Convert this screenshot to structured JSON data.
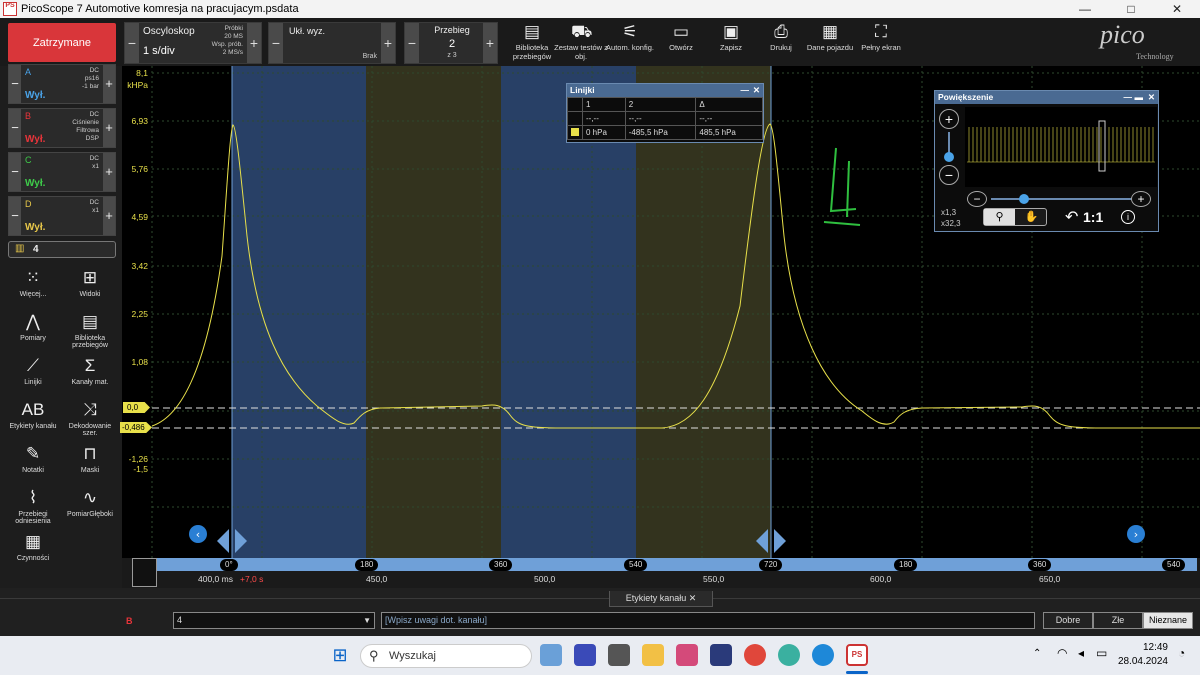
{
  "window": {
    "title": "PicoScope 7 Automotive komresja na pracujacym.psdata",
    "logo_text": "PS",
    "minimize": "—",
    "maximize": "□",
    "close": "✕"
  },
  "toolbar": {
    "stop_label": "Zatrzymane",
    "scope": {
      "title": "Oscyloskop",
      "timebase": "1 s/div",
      "samples_label": "Próbki",
      "samples_value": "20 MS",
      "rate_label": "Wsp. prób.",
      "rate_value": "2 MS/s"
    },
    "trigger": {
      "title": "Ukł. wyz.",
      "value": "Brak"
    },
    "waveform": {
      "title": "Przebieg",
      "value": "2",
      "of": "z 3"
    },
    "buttons": [
      {
        "label": "Biblioteka przebiegów",
        "icon": "library-icon"
      },
      {
        "label": "Zestaw testów z obj.",
        "icon": "car-icon"
      },
      {
        "label": "Autom. konfig.",
        "icon": "wand-icon"
      },
      {
        "label": "Otwórz",
        "icon": "folder-icon"
      },
      {
        "label": "Zapisz",
        "icon": "save-icon"
      },
      {
        "label": "Drukuj",
        "icon": "print-icon"
      },
      {
        "label": "Dane pojazdu",
        "icon": "clipboard-icon"
      },
      {
        "label": "Pełny ekran",
        "icon": "fullscreen-icon"
      }
    ],
    "brand": "pico",
    "brand_sub": "Technology"
  },
  "channels": [
    {
      "name": "A",
      "state": "Wył.",
      "info1": "DC",
      "info2": "ps16",
      "info3": "-1 bar",
      "info4": "",
      "color": "#4aa3e8"
    },
    {
      "name": "B",
      "state": "Wył.",
      "info1": "DC",
      "info2": "Ciśnienie",
      "info3": "Filtrowa",
      "info4": "DSP",
      "color": "#e8343a"
    },
    {
      "name": "C",
      "state": "Wył.",
      "info1": "DC",
      "info2": "x1",
      "info3": "",
      "info4": "",
      "color": "#3ecc4a"
    },
    {
      "name": "D",
      "state": "Wył.",
      "info1": "DC",
      "info2": "x1",
      "info3": "",
      "info4": "",
      "color": "#e8c84a"
    }
  ],
  "math_count": "4",
  "tools": [
    {
      "label": "Więcej...",
      "icon": "grid-dots-icon",
      "glyph": "⁙"
    },
    {
      "label": "Widoki",
      "icon": "views-icon",
      "glyph": "⊞"
    },
    {
      "label": "Pomiary",
      "icon": "compass-icon",
      "glyph": "⋀"
    },
    {
      "label": "Biblioteka przebiegów",
      "icon": "library-icon",
      "glyph": "▤"
    },
    {
      "label": "Linijki",
      "icon": "ruler-icon",
      "glyph": "⟋"
    },
    {
      "label": "Kanały mat.",
      "icon": "sigma-icon",
      "glyph": "Σ"
    },
    {
      "label": "Etykiety kanału",
      "icon": "abcd-icon",
      "glyph": "AB"
    },
    {
      "label": "Dekodowanie szer.",
      "icon": "decode-icon",
      "glyph": "⤨"
    },
    {
      "label": "Notatki",
      "icon": "notes-icon",
      "glyph": "✎"
    },
    {
      "label": "Maski",
      "icon": "mask-icon",
      "glyph": "⊓"
    },
    {
      "label": "Przebiegi odniesienia",
      "icon": "reference-icon",
      "glyph": "⌇"
    },
    {
      "label": "PomiarGłęboki",
      "icon": "deep-measure-icon",
      "glyph": "∿"
    },
    {
      "label": "Czynności",
      "icon": "clapper-icon",
      "glyph": "▦"
    }
  ],
  "plot": {
    "y_unit": "kHPa",
    "y_ticks": [
      "8,1",
      "6,93",
      "5,76",
      "4,59",
      "3,42",
      "2,25",
      "1,08",
      "-1,26",
      "-1,5"
    ],
    "marker_ticks": [
      "0,0",
      "-0,486"
    ],
    "ruler_hpa": [
      0,
      -485.5
    ],
    "colors": {
      "trace": "#e8e04a",
      "shade_blue": "#3a5a8a",
      "shade_olive": "#3f3f22"
    },
    "handwritten": "4",
    "timeline_rotation": [
      "0°",
      "180",
      "360",
      "540",
      "720",
      "180",
      "360",
      "540"
    ],
    "time_labels": [
      "400,0 ms",
      "450,0",
      "500,0",
      "550,0",
      "600,0",
      "650,0"
    ],
    "time_offset": "+7,0 s"
  },
  "rulers_panel": {
    "title": "Linijki",
    "headers": [
      "1",
      "2",
      "Δ"
    ],
    "row1": [
      "--,--",
      "--,--",
      "--,--"
    ],
    "row2": [
      "0 hPa",
      "-485,5 hPa",
      "485,5 hPa"
    ]
  },
  "zoom_panel": {
    "title": "Powiększenie",
    "zoom_x": "x1,3",
    "zoom_y": "x32,3",
    "reset": "1:1"
  },
  "bottom": {
    "tab": "Etykiety kanału",
    "channel": "B",
    "select": "4",
    "note_placeholder": "[Wpisz uwagi dot. kanału]",
    "buttons": [
      "Dobre",
      "Złe",
      "Nieznane"
    ]
  },
  "taskbar": {
    "search": "Wyszukaj",
    "time": "12:49",
    "date": "28.04.2024"
  }
}
